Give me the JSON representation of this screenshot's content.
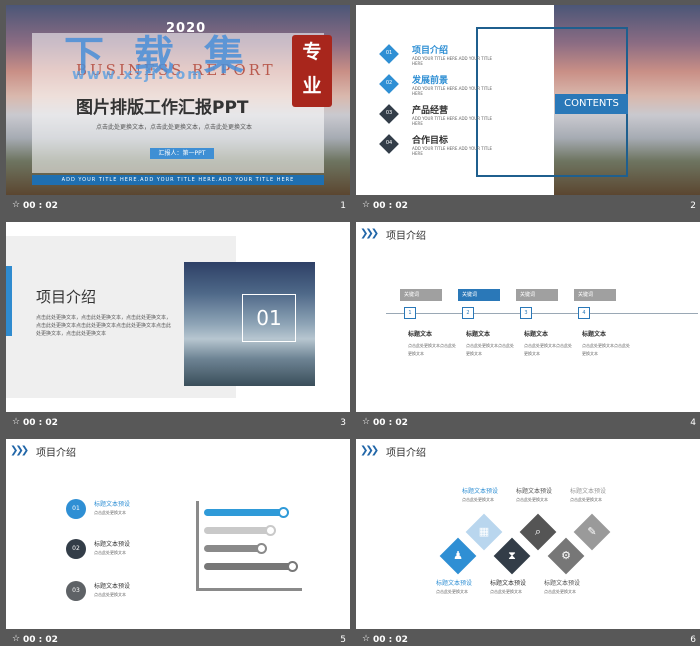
{
  "slides": [
    {
      "number": "1",
      "time": "00 : 02",
      "year": "2020",
      "business": "BUSINESS REPORT",
      "watermark": "下 载 集",
      "watermark_url": "www.xzji.com",
      "seal": [
        "专",
        "业"
      ],
      "title": "图片排版工作汇报PPT",
      "subtitle": "点击此处更换文本，点击此处更换文本，点击此处更换文本",
      "reporter": "汇报人：第一PPT",
      "footer": "ADD YOUR TITLE HERE.ADD YOUR TITLE HERE.ADD YOUR TITLE HERE"
    },
    {
      "number": "2",
      "time": "00 : 02",
      "contents_label": "CONTENTS",
      "items": [
        {
          "num": "01",
          "title": "项目介绍",
          "sub": "ADD YOUR TITLE HERE.ADD YOUR TITLE HERE"
        },
        {
          "num": "02",
          "title": "发展前景",
          "sub": "ADD YOUR TITLE HERE.ADD YOUR TITLE HERE"
        },
        {
          "num": "03",
          "title": "产品经营",
          "sub": "ADD YOUR TITLE HERE.ADD YOUR TITLE HERE"
        },
        {
          "num": "04",
          "title": "合作目标",
          "sub": "ADD YOUR TITLE HERE.ADD YOUR TITLE HERE"
        }
      ]
    },
    {
      "number": "3",
      "time": "00 : 02",
      "title": "项目介绍",
      "body": "点击此处更换文本，点击此处更换文本，点击此处更换文本，点击此处更换文本点击此处更换文本点击此处更换文本点击此处更换文本，点击此处更换文本",
      "box_number": "01"
    },
    {
      "number": "4",
      "time": "00 : 02",
      "header": "项目介绍",
      "steps": [
        {
          "key": "关键词",
          "node": "1",
          "label": "标题文本",
          "desc": "点击此处更换文本点击此处更换文本"
        },
        {
          "key": "关键词",
          "node": "2",
          "label": "标题文本",
          "desc": "点击此处更换文本点击此处更换文本"
        },
        {
          "key": "关键词",
          "node": "3",
          "label": "标题文本",
          "desc": "点击此处更换文本点击此处更换文本"
        },
        {
          "key": "关键词",
          "node": "4",
          "label": "标题文本",
          "desc": "点击此处更换文本点击此处更换文本"
        }
      ],
      "colors": {
        "accent": "#2a78b8",
        "muted": "#a0a0a0"
      }
    },
    {
      "number": "5",
      "time": "00 : 02",
      "header": "项目介绍",
      "items": [
        {
          "num": "01",
          "title": "标题文本预设",
          "sub": "点击此处更换文本",
          "color": "#2f8fd4"
        },
        {
          "num": "02",
          "title": "标题文本预设",
          "sub": "点击此处更换文本",
          "color": "#333d48"
        },
        {
          "num": "03",
          "title": "标题文本预设",
          "sub": "点击此处更换文本",
          "color": "#5e6266"
        }
      ],
      "bars": [
        {
          "fill": 0.85,
          "color": "#2f9ad8"
        },
        {
          "fill": 0.72,
          "color": "#c9c9c9"
        },
        {
          "fill": 0.62,
          "color": "#8a8a8a"
        },
        {
          "fill": 0.95,
          "color": "#777777"
        }
      ]
    },
    {
      "number": "6",
      "time": "00 : 02",
      "header": "项目介绍",
      "top_items": [
        {
          "title": "标题文本预设",
          "sub": "点击此处更换文本"
        },
        {
          "title": "标题文本预设",
          "sub": "点击此处更换文本"
        },
        {
          "title": "标题文本预设",
          "sub": "点击此处更换文本"
        }
      ],
      "bottom_items": [
        {
          "title": "标题文本预设",
          "sub": "点击此处更换文本"
        },
        {
          "title": "标题文本预设",
          "sub": "点击此处更换文本"
        },
        {
          "title": "标题文本预设",
          "sub": "点击此处更换文本"
        }
      ]
    }
  ],
  "icons": {
    "star": "star-icon",
    "chevron": "double-chevron-icon"
  }
}
